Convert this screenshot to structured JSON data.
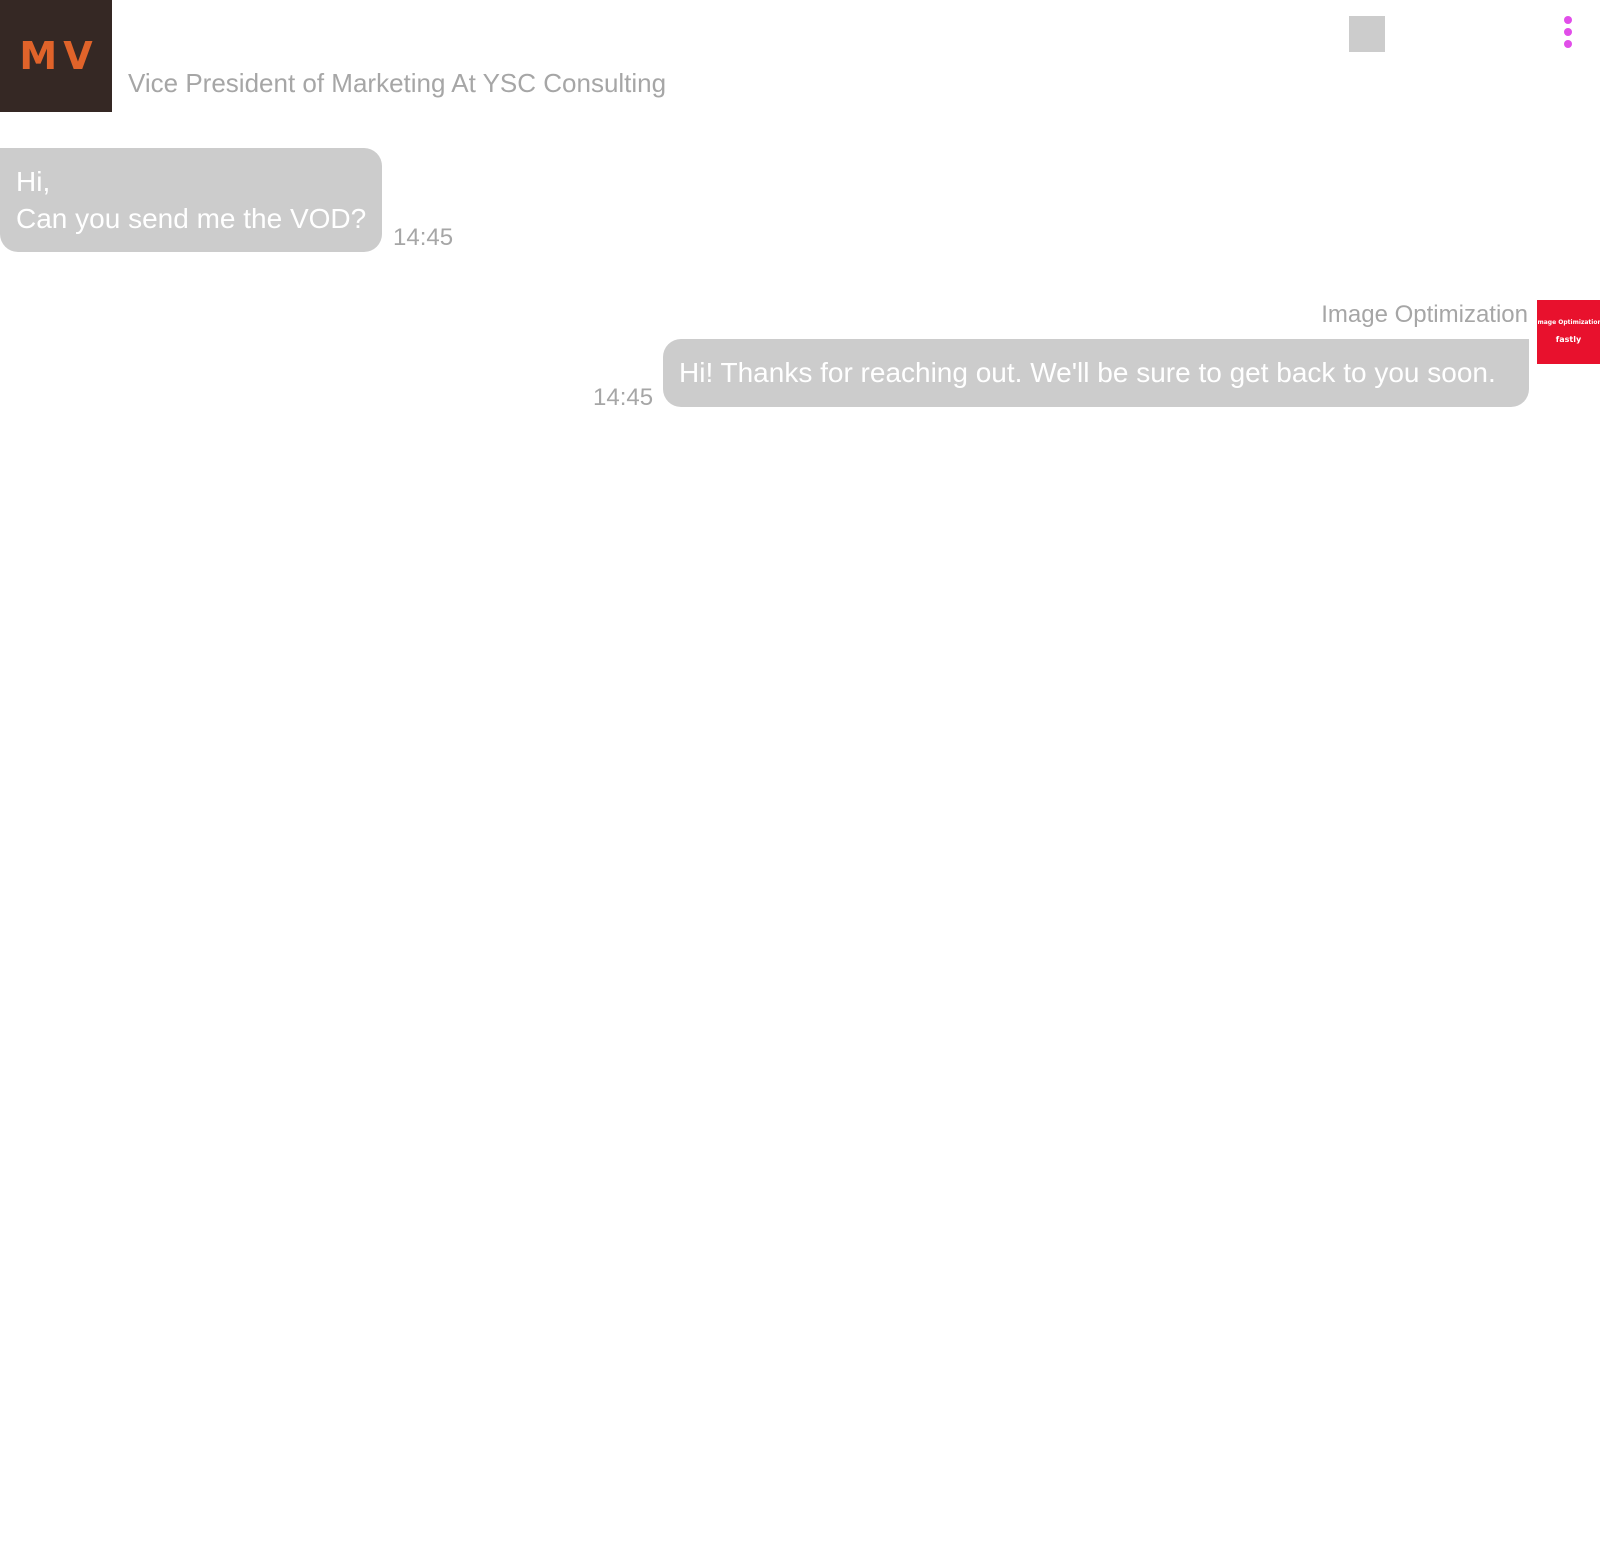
{
  "header": {
    "avatar_initials": "MV",
    "subtitle": "Vice President of Marketing At YSC Consulting",
    "menu_icon": "more-vertical-icon"
  },
  "messages": [
    {
      "direction": "incoming",
      "lines": [
        "Hi,",
        "Can you send me the VOD?"
      ],
      "time": "14:45"
    },
    {
      "direction": "outgoing",
      "sender": "Image Optimization",
      "text": "Hi! Thanks for reaching out. We'll be sure to get back to you soon.",
      "time": "14:45",
      "avatar_logo_top": "Image Optimization",
      "avatar_logo_bottom": "fastly"
    }
  ],
  "colors": {
    "accent": "#e14ee9",
    "brand": "#e8112d",
    "avatar_bg": "#352824",
    "avatar_text": "#e0632a",
    "bubble": "#cccccc"
  }
}
